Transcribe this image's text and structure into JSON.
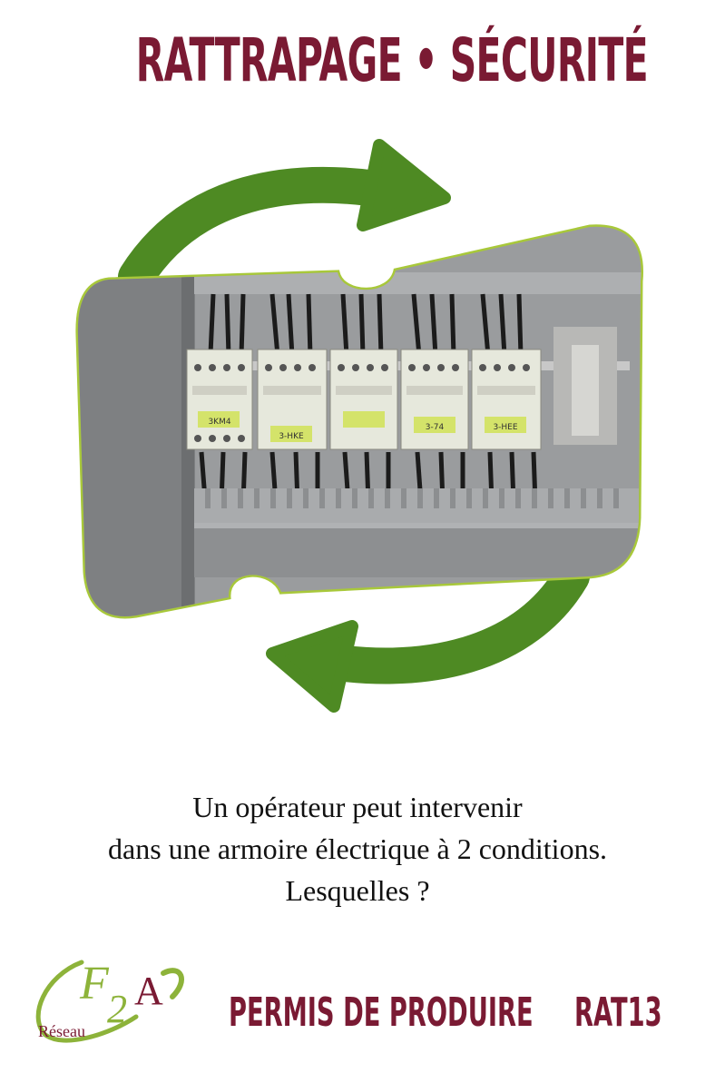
{
  "title": "RATTRAPAGE • SÉCURITÉ",
  "question": {
    "line1": "Un opérateur peut intervenir",
    "line2": "dans une armoire électrique à 2 conditions.",
    "line3": "Lesquelles ?"
  },
  "logo": {
    "letters_f": "F",
    "letters_2": "2",
    "letters_a": "A",
    "subtext": "Réseau"
  },
  "footer": {
    "program": "PERMIS DE PRODUIRE",
    "code": "RAT13"
  },
  "contactor_labels": [
    "3KM4",
    "3-HKE",
    "",
    "3-74",
    "3-HEE"
  ],
  "colors": {
    "title": "#7a1a33",
    "arrow": "#4e8a23",
    "frame_border": "#a8c83a",
    "question_text": "#111111"
  }
}
